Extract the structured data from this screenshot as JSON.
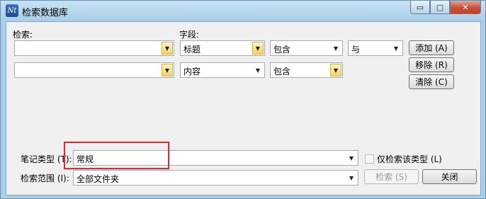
{
  "window": {
    "title": "检索数据库",
    "app_icon_text": "Nt",
    "controls": {
      "minimize": "▭",
      "maximize": "▢",
      "close": "✕"
    }
  },
  "labels": {
    "search": "检索:",
    "field": "字段:",
    "note_type": "笔记类型 (T):",
    "scope": "检索范围 (I):",
    "only_this_type": "仅检索该类型 (L)"
  },
  "criteria_rows": [
    {
      "term": "",
      "field": "标题",
      "op": "包含",
      "join": "与"
    },
    {
      "term": "",
      "field": "内容",
      "op": "包含"
    }
  ],
  "buttons": {
    "add": "添加 (A)",
    "remove": "移除 (R)",
    "clear": "清除 (C)",
    "search": "检索 (S)",
    "close": "关闭"
  },
  "note_type_value": "常规",
  "scope_value": "全部文件夹",
  "only_this_type_checked": false,
  "search_enabled": false
}
